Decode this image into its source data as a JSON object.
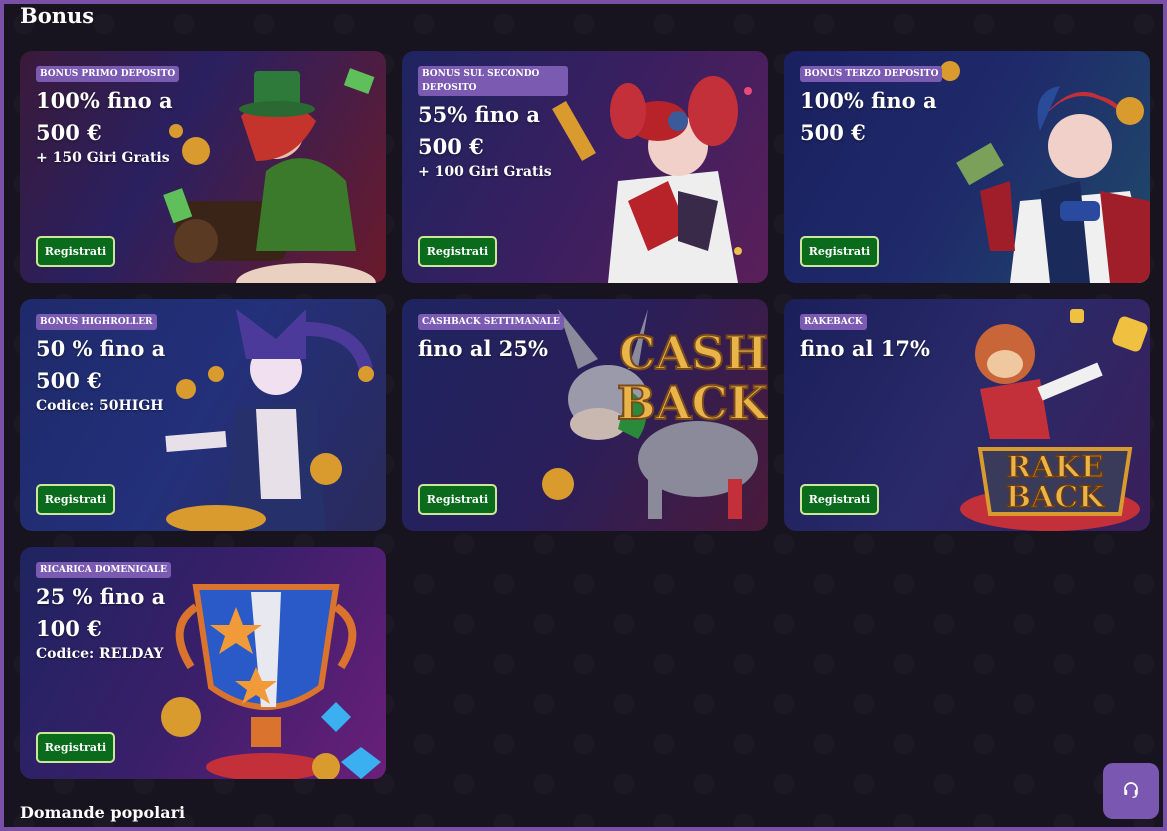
{
  "page": {
    "title": "Bonus",
    "faq_title": "Domande popolari"
  },
  "cards": [
    {
      "badge": "BONUS PRIMO DEPOSITO",
      "headline": "100% fino a\n500 €",
      "sub": "+ 150 Giri Gratis",
      "button": "Registrati",
      "art": "joker-green-hat"
    },
    {
      "badge": "BONUS SUL SECONDO DEPOSITO",
      "headline": "55% fino a\n500 €",
      "sub": "+ 100 Giri Gratis",
      "button": "Registrati",
      "art": "harlequin-girl"
    },
    {
      "badge": "BONUS TERZO DEPOSITO",
      "headline": "100% fino a\n500 €",
      "sub": "",
      "button": "Registrati",
      "art": "joker-cash"
    },
    {
      "badge": "BONUS HIGHROLLER",
      "headline": "50 % fino a\n 500 €",
      "sub": "Codice: 50HIGH",
      "button": "Registrati",
      "art": "jester-purple"
    },
    {
      "badge": "CASHBACK SETTIMANALE",
      "headline": "fino al 25%",
      "sub": "",
      "button": "Registrati",
      "art": "donkey-cashback"
    },
    {
      "badge": "RAKEBACK",
      "headline": "fino al 17%",
      "sub": "",
      "button": "Registrati",
      "art": "monkey-rakeback"
    },
    {
      "badge": "RICARICA DOMENICALE",
      "headline": "25 % fino a\n100 €",
      "sub": "Codice: RELDAY",
      "button": "Registrati",
      "art": "trophy-cup"
    }
  ],
  "art_text": {
    "cash": "CASH",
    "back": "BACK",
    "rake": "RAKE",
    "rake_back": "BACK"
  },
  "support": {
    "icon": "headset-icon"
  },
  "colors": {
    "accent": "#7b5bb2",
    "button_bg": "#0b6b1c",
    "button_border": "#cde79a",
    "background": "#17131f"
  }
}
